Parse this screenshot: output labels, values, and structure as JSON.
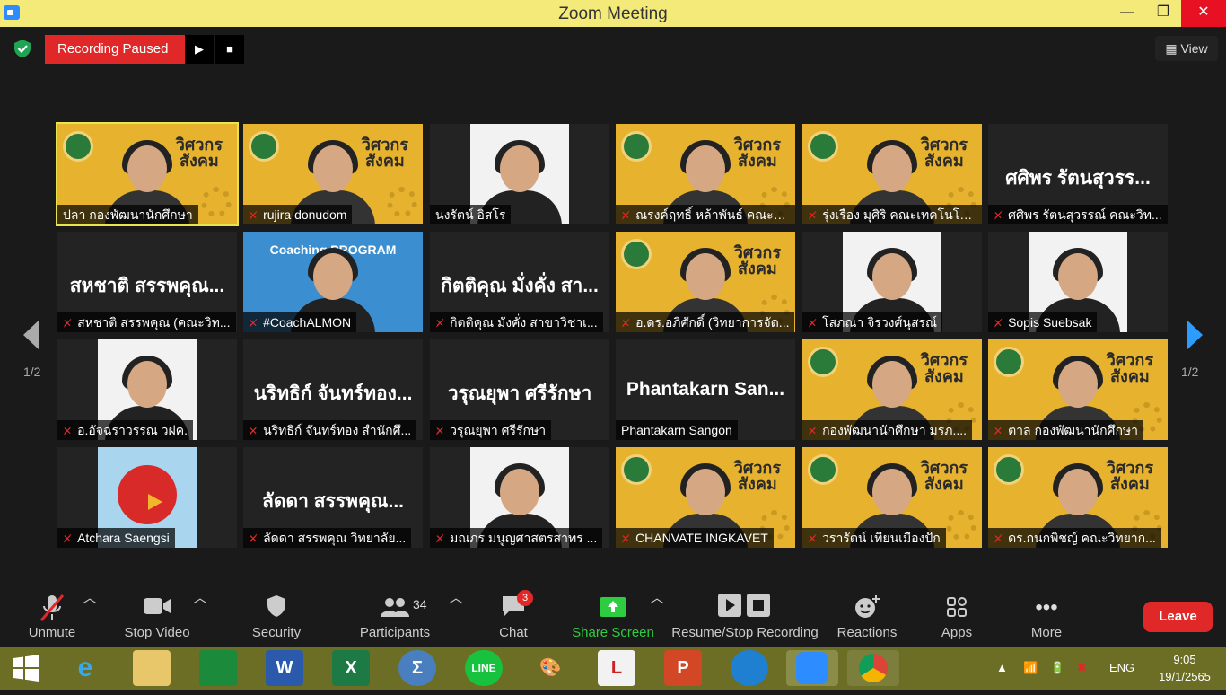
{
  "window": {
    "title": "Zoom Meeting",
    "minimize": "—",
    "maximize": "❐",
    "close": "✕"
  },
  "recording": {
    "status": "Recording Paused",
    "play_icon": "▶",
    "stop_icon": "■"
  },
  "view": {
    "label": "View"
  },
  "pagination": {
    "prev": "1/2",
    "next": "1/2"
  },
  "participants": [
    {
      "name": "ปลา กองพัฒนานักศึกษา",
      "muted": false,
      "active": true,
      "kind": "slide"
    },
    {
      "name": "rujira donudom",
      "muted": true,
      "kind": "slide"
    },
    {
      "name": "นงรัตน์ อิสโร",
      "muted": false,
      "kind": "photo"
    },
    {
      "name": "ณรงค์ฤทธิ์ หล้าพันธ์ คณะวิ...",
      "muted": true,
      "kind": "slide"
    },
    {
      "name": "รุ่งเรือง มุศิริ คณะเทคโนโลย...",
      "muted": true,
      "kind": "slide"
    },
    {
      "name": "ศศิพร รัตนสุวรรณ์ คณะวิท...",
      "muted": true,
      "kind": "name",
      "big": "ศศิพร รัตนสุวรร..."
    },
    {
      "name": "สหชาติ สรรพคุณ (คณะวิท...",
      "muted": true,
      "kind": "name",
      "big": "สหชาติ สรรพคุณ..."
    },
    {
      "name": "#CoachALMON",
      "muted": true,
      "kind": "coach",
      "banner": "Coaching PROGRAM"
    },
    {
      "name": "กิตติคุณ มั่งคั่ง สาขาวิชาเ...",
      "muted": true,
      "kind": "name",
      "big": "กิตติคุณ มั่งคั่ง สา..."
    },
    {
      "name": "อ.ดร.อภิศักดิ์ (วิทยาการจัด...",
      "muted": true,
      "kind": "slide"
    },
    {
      "name": "โสภณา จิรวงศ์นุสรณ์",
      "muted": true,
      "kind": "photo"
    },
    {
      "name": "Sopis Suebsak",
      "muted": true,
      "kind": "photo"
    },
    {
      "name": "อ.อัจฉราวรรณ วฝค.",
      "muted": true,
      "kind": "photo"
    },
    {
      "name": "นริทธิก์ จันทร์ทอง สำนักศึ...",
      "muted": true,
      "kind": "name",
      "big": "นริทธิก์ จันทร์ทอง..."
    },
    {
      "name": "วรุณยุพา ศรีรักษา",
      "muted": true,
      "kind": "name",
      "big": "วรุณยุพา ศรีรักษา"
    },
    {
      "name": "Phantakarn Sangon",
      "muted": false,
      "kind": "name",
      "big": "Phantakarn San..."
    },
    {
      "name": "กองพัฒนานักศึกษา มรภ....",
      "muted": true,
      "kind": "slide"
    },
    {
      "name": "ตาล กองพัฒนานักศึกษา",
      "muted": true,
      "kind": "slide"
    },
    {
      "name": "Atchara Saengsi",
      "muted": true,
      "kind": "bird"
    },
    {
      "name": "ลัดดา สรรพคุณ วิทยาลัย...",
      "muted": true,
      "kind": "name",
      "big": "ลัดดา สรรพคุณ..."
    },
    {
      "name": "มณภร มนูญศาสตรสาทร ...",
      "muted": true,
      "kind": "photo"
    },
    {
      "name": "CHANVATE INGKAVET",
      "muted": true,
      "kind": "slide"
    },
    {
      "name": "วรารัตน์ เทียนเมืองปัก",
      "muted": true,
      "kind": "slide"
    },
    {
      "name": "ดร.กนกพิชญ์ คณะวิทยาก...",
      "muted": true,
      "kind": "slide"
    }
  ],
  "slide_brand": "วิศวกร\nสังคม",
  "toolbar": {
    "unmute": "Unmute",
    "stop_video": "Stop Video",
    "security": "Security",
    "participants": "Participants",
    "participants_count": "34",
    "chat": "Chat",
    "chat_badge": "3",
    "share_screen": "Share Screen",
    "resume_stop": "Resume/Stop Recording",
    "reactions": "Reactions",
    "apps": "Apps",
    "more": "More",
    "leave": "Leave"
  },
  "taskbar": {
    "language": "ENG",
    "time": "9:05",
    "date": "19/1/2565"
  },
  "colors": {
    "title_bar": "#f4ea7a",
    "record": "#e02828",
    "share": "#2ecc40",
    "accent": "#2d8cff",
    "taskbar": "#6b6e24"
  }
}
